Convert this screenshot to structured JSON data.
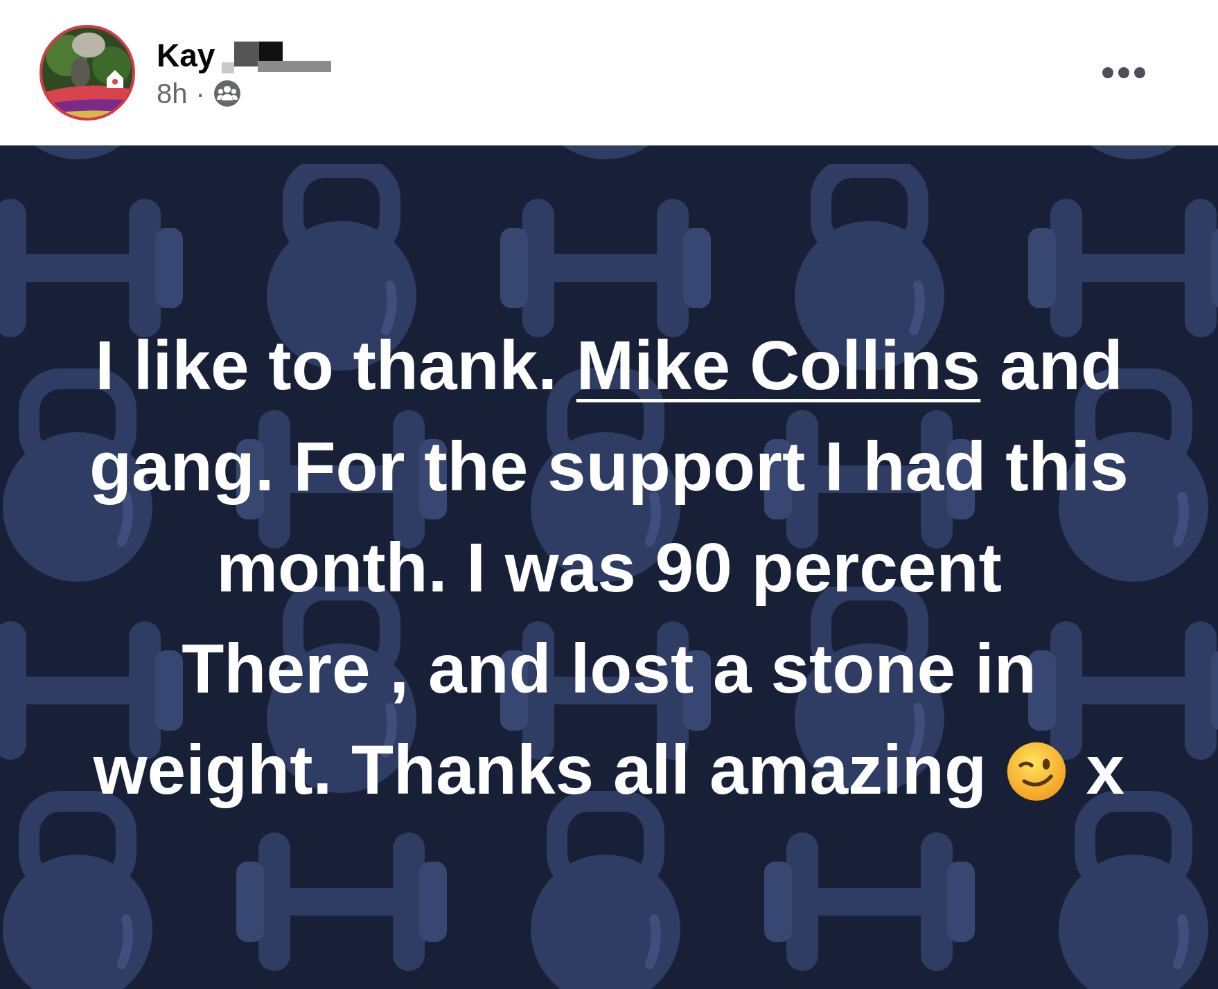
{
  "post": {
    "author": {
      "name": "Kay",
      "name_redacted": true
    },
    "time": "8h",
    "separator": "·",
    "body": {
      "text_before_link": "I like to thank.",
      "link": "Mike Collins",
      "text_after_link": "and gang. For the support I had this month. I was 90 percent\nThere , and lost a stone in weight. Thanks all amazing",
      "text_end": "x"
    }
  }
}
